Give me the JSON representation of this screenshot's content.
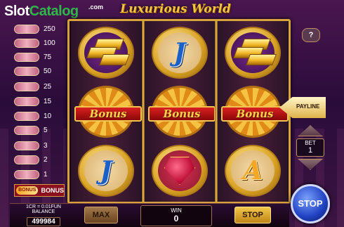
{
  "logo": {
    "slot": "Slot",
    "catalog": "Catalog",
    "com": ".com"
  },
  "game_title": "Luxurious World",
  "reels": [
    [
      "gold-bars",
      "bonus-wheel",
      "letter-J"
    ],
    [
      "letter-J",
      "bonus-wheel",
      "ruby-ring"
    ],
    [
      "gold-bars",
      "bonus-wheel",
      "letter-A"
    ]
  ],
  "symbol_text": {
    "bonus": "Bonus",
    "j": "J",
    "a": "A"
  },
  "paytable": {
    "values": [
      "250",
      "100",
      "75",
      "50",
      "25",
      "15",
      "10",
      "5",
      "3",
      "2",
      "1"
    ],
    "bonus_chip": "BONUS",
    "bonus_label": "BONUS"
  },
  "controls": {
    "help_label": "?",
    "payline_label": "PAYLINE",
    "bet_label": "BET",
    "bet_value": "1",
    "stop_big_label": "STOP",
    "max_label": "MAX",
    "stop_label": "STOP"
  },
  "balance": {
    "rate": "1CR = 0.01FUN",
    "label": "BALANCE",
    "value": "499984"
  },
  "win": {
    "label": "WIN",
    "value": "0"
  },
  "colors": {
    "frame_gold": "#d8a33a",
    "title_gold": "#f5c342",
    "bonus_red": "#d82020",
    "stop_blue": "#2040c0"
  }
}
